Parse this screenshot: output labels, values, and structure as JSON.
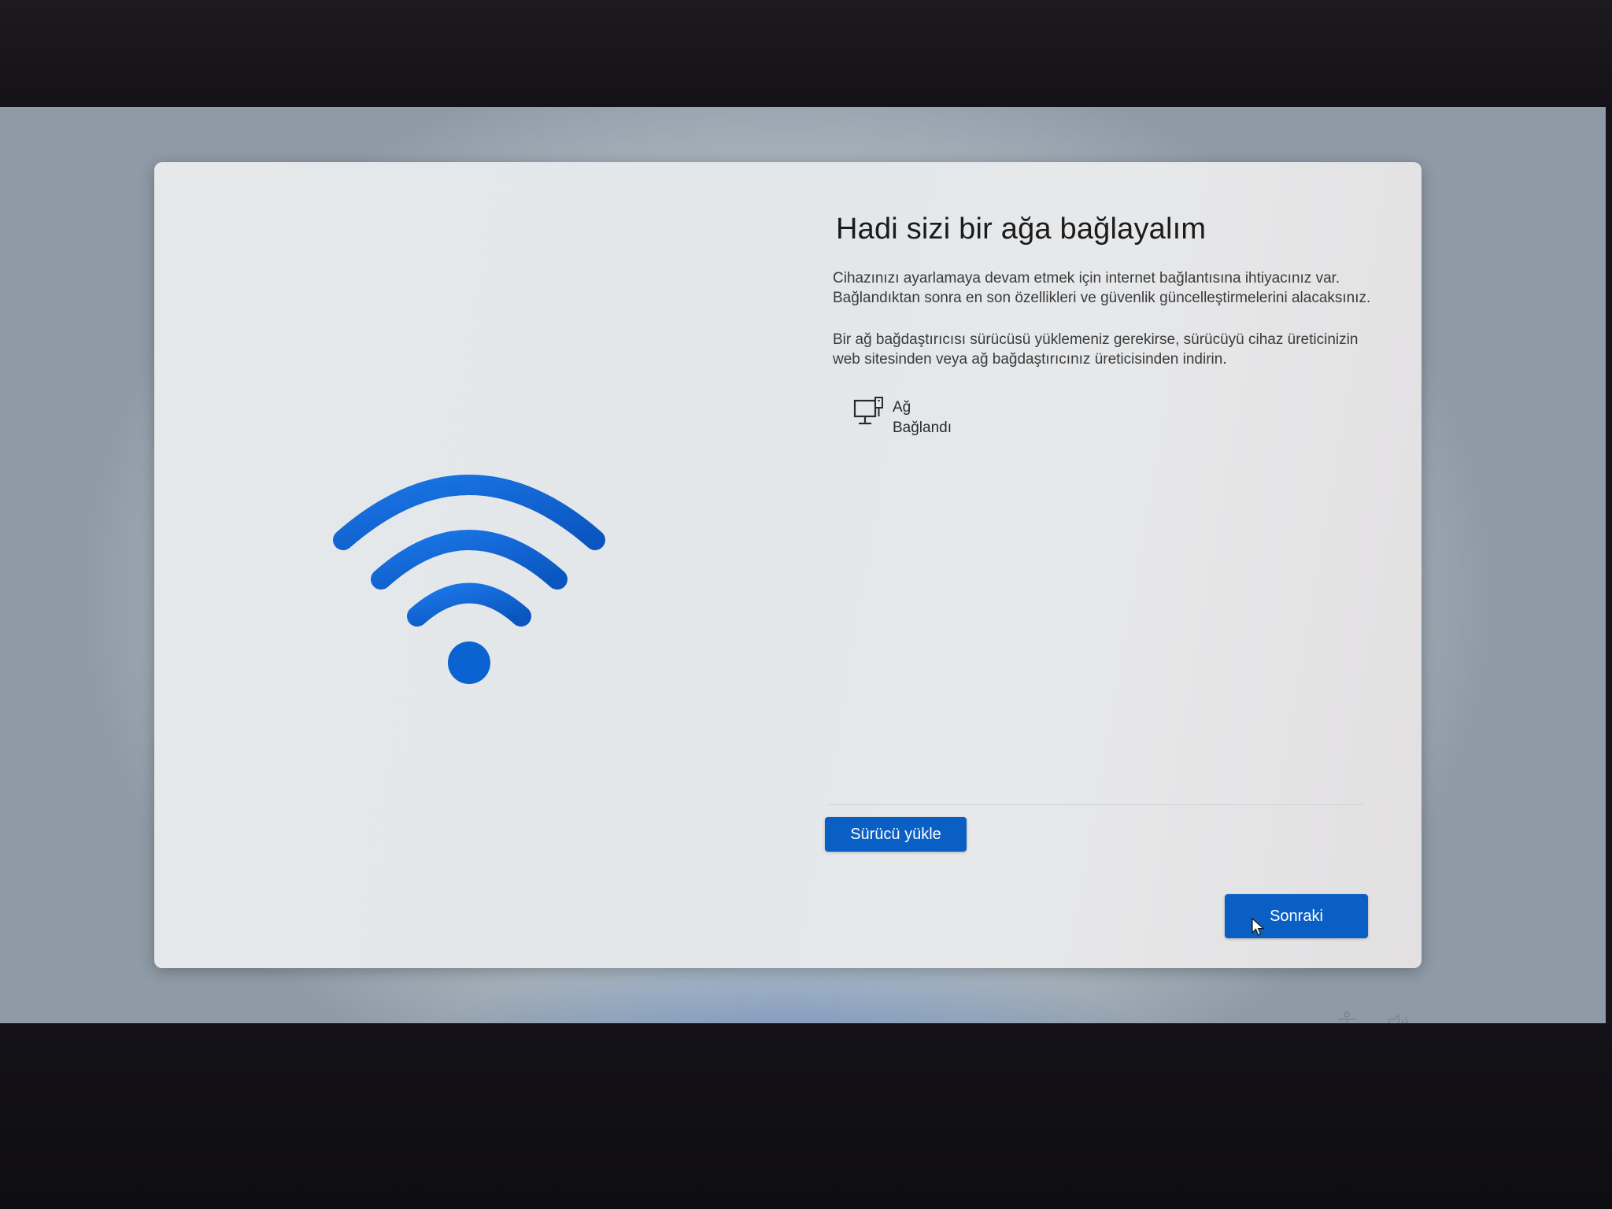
{
  "page": {
    "title": "Hadi sizi bir ağa bağlayalım",
    "description_1": "Cihazınızı ayarlamaya devam etmek için internet bağlantısına ihtiyacınız var. Bağlandıktan sonra en son özellikleri ve güvenlik güncelleştirmelerini alacaksınız.",
    "description_2": "Bir ağ bağdaştırıcısı sürücüsü yüklemeniz gerekirse, sürücüyü cihaz üreticinizin web sitesinden veya ağ bağdaştırıcınız üreticisinden indirin."
  },
  "network": {
    "name": "Ağ",
    "status": "Bağlandı",
    "icon": "wired-network-icon"
  },
  "buttons": {
    "install_driver": "Sürücü yükle",
    "next": "Sonraki"
  },
  "tray": {
    "icons": [
      "accessibility-icon",
      "volume-icon"
    ]
  },
  "colors": {
    "accent": "#0a5fc4",
    "wifi_blue": "#0b63d1"
  }
}
